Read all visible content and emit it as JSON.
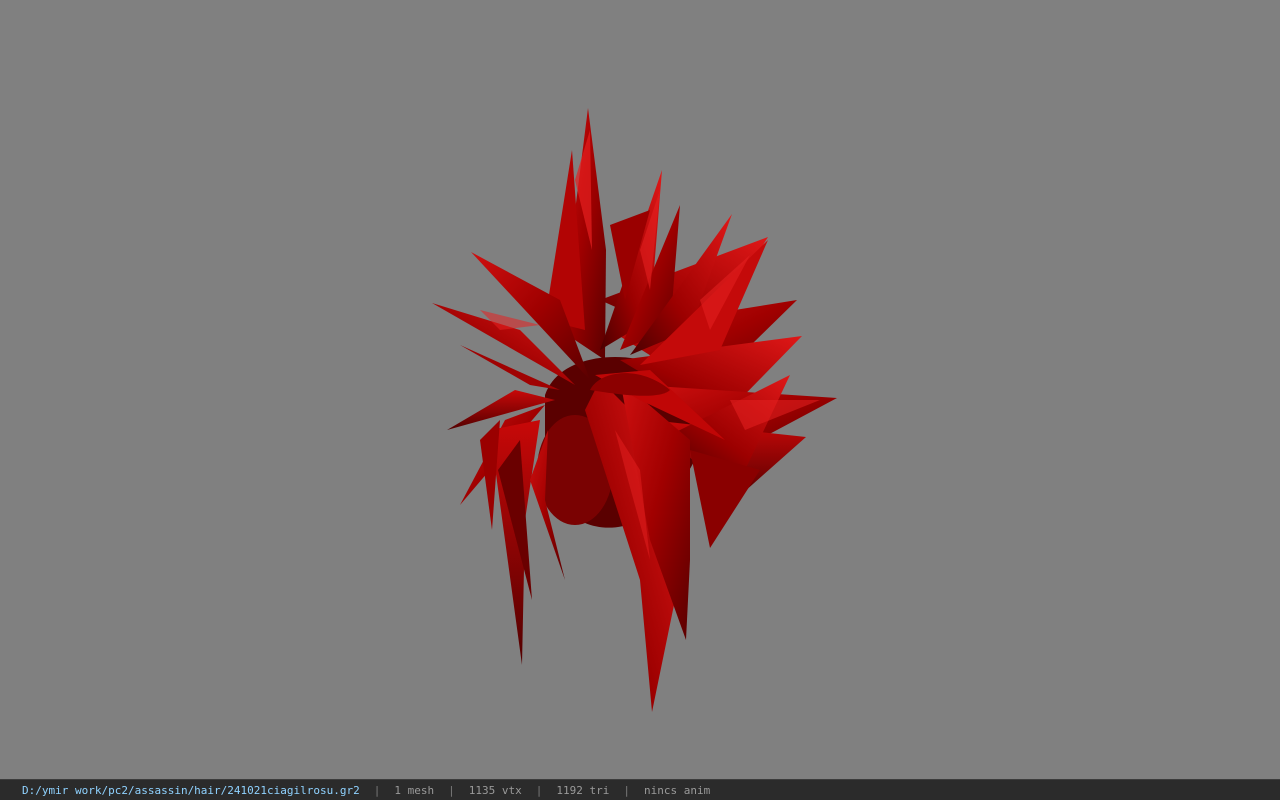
{
  "viewer": {
    "background_color": "#808080",
    "model_color": "#b00000"
  },
  "status_bar": {
    "file_path": "D:/ymir work/pc2/assassin/hair/241021ciagilrosu.gr2",
    "separator": "|",
    "mesh_count": "1 mesh",
    "vertex_count": "1135 vtx",
    "triangle_count": "1192 tri",
    "animation": "nincs anim"
  }
}
